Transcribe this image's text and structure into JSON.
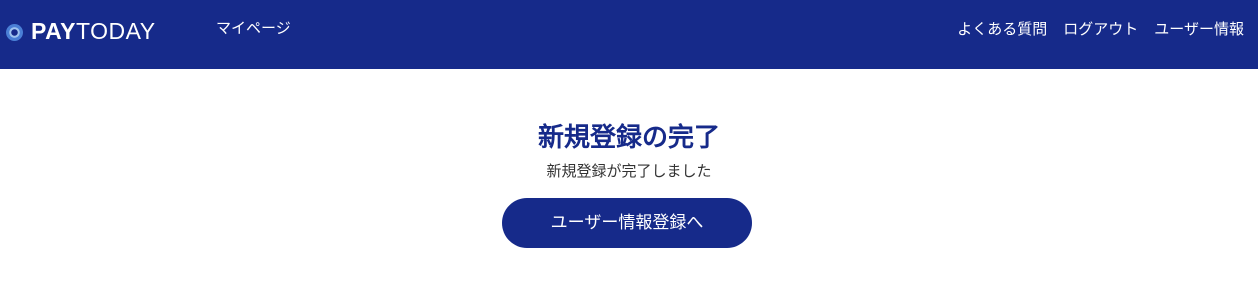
{
  "header": {
    "logo": {
      "part_bold": "PAY",
      "part_light": "TODAY",
      "icon": "circle-logo-icon"
    },
    "nav_left": "マイページ",
    "nav_right": [
      "よくある質問",
      "ログアウト",
      "ユーザー情報"
    ],
    "background_color": "#162a8a"
  },
  "main": {
    "title": "新規登録の完了",
    "subtitle": "新規登録が完了しました",
    "button_label": "ユーザー情報登録へ",
    "accent_color": "#162a8a"
  }
}
